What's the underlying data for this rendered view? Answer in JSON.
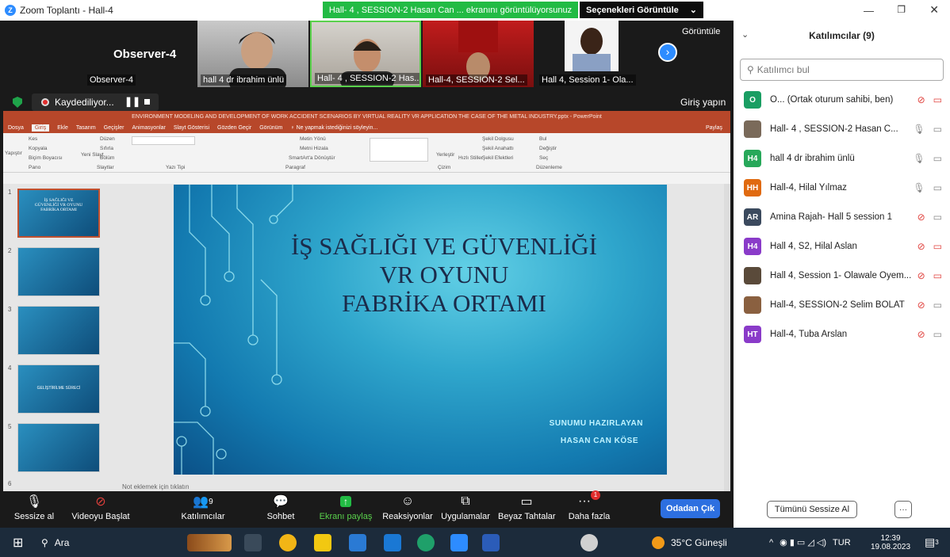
{
  "window": {
    "title": "Zoom Toplantı - Hall-4"
  },
  "share_banner": {
    "text": "Hall- 4 , SESSION-2 Hasan Can ... ekranını görüntülüyorsunuz"
  },
  "view_options": {
    "label": "Seçenekleri Görüntüle",
    "chevron": "⌄"
  },
  "video_strip": {
    "observer_big": "Observer-4",
    "tiles": [
      {
        "name": "Observer-4"
      },
      {
        "name": "hall 4 dr ibrahim ünlü"
      },
      {
        "name": "Hall- 4 , SESSION-2 Has..."
      },
      {
        "name": "Hall-4, SESSION-2 Sel..."
      },
      {
        "name": "Hall 4, Session 1- Ola..."
      }
    ],
    "view_label": "Görüntüle"
  },
  "recording": {
    "label": "Kaydediliyor...",
    "signin": "Giriş yapın"
  },
  "ppt": {
    "title": "ENVIRONMENT MODELING AND DEVELOPMENT OF WORK ACCIDENT SCENARIOS BY VIRTUAL REALITY VR APPLICATION THE CASE OF THE METAL INDUSTRY.pptx - PowerPoint",
    "tabs": [
      "Dosya",
      "Giriş",
      "Ekle",
      "Tasarım",
      "Geçişler",
      "Animasyonlar",
      "Slayt Gösterisi",
      "Gözden Geçir",
      "Görünüm",
      "♀ Ne yapmak istediğinizi söyleyin..."
    ],
    "share": "Paylaş",
    "ribbon": {
      "paste": "Yapıştır",
      "cut": "Kes",
      "copy": "Kopyala",
      "format": "Biçim Boyacısı",
      "group_clipboard": "Pano",
      "new_slide": "Yeni Slayt",
      "layout": "Düzen",
      "reset": "Sıfırla",
      "section": "Bölüm",
      "group_slides": "Slaytlar",
      "group_font": "Yazı Tipi",
      "text_dir": "Metin Yönü",
      "align": "Metni Hizala",
      "smartart": "SmartArt'a Dönüştür",
      "group_para": "Paragraf",
      "arrange": "Yerleştir",
      "quick": "Hızlı Stiller",
      "fill": "Şekil Dolgusu",
      "outline": "Şekil Anahattı",
      "effects": "Şekil Efektleri",
      "group_draw": "Çizim",
      "find": "Bul",
      "replace": "Değiştir",
      "select": "Seç",
      "group_edit": "Düzenleme"
    },
    "thumb_numbers": [
      "1",
      "2",
      "3",
      "4",
      "5",
      "6"
    ],
    "thumb1_title": "İŞ SAĞLIĞI VE GÜVENLİĞİ VR OYUNU FABRİKA ORTAMI",
    "thumb4_title": "GELİŞTİRİLME SÜRECİ",
    "notes": "Not eklemek için tıklatın",
    "slide": {
      "line1": "İŞ SAĞLIĞI VE GÜVENLİĞİ",
      "line2": "VR OYUNU",
      "line3": "FABRİKA ORTAMI",
      "sub1": "SUNUMU HAZIRLAYAN",
      "sub2": "HASAN CAN KÖSE"
    }
  },
  "controls": {
    "mute": "Sessize al",
    "video": "Videoyu Başlat",
    "participants": "Katılımcılar",
    "participants_count": "9",
    "chat": "Sohbet",
    "share": "Ekranı paylaş",
    "reactions": "Reaksiyonlar",
    "apps": "Uygulamalar",
    "whiteboard": "Beyaz Tahtalar",
    "more": "Daha fazla",
    "more_badge": "1",
    "leave": "Odadan Çık"
  },
  "panel": {
    "title": "Katılımcılar (9)",
    "search_placeholder": "Katılımcı bul",
    "participants": [
      {
        "initials": "O",
        "name": "O... (Ortak oturum sahibi, ben)",
        "color": "#1a9e63",
        "muted": true,
        "video_off": true
      },
      {
        "initials": "",
        "name": "Hall- 4 , SESSION-2 Hasan C...",
        "color": "#7a6a5a",
        "muted": false,
        "video_off": false
      },
      {
        "initials": "H4",
        "name": "hall 4 dr ibrahim ünlü",
        "color": "#27a85a",
        "muted": false,
        "video_off": false
      },
      {
        "initials": "HH",
        "name": "Hall-4, Hilal Yılmaz",
        "color": "#e06a10",
        "muted": false,
        "video_off": false
      },
      {
        "initials": "AR",
        "name": "Amina Rajah- Hall 5 session 1",
        "color": "#3b4a5e",
        "muted": true,
        "video_off": false
      },
      {
        "initials": "H4",
        "name": "Hall 4, S2, Hilal Aslan",
        "color": "#8a3bc9",
        "muted": true,
        "video_off": true
      },
      {
        "initials": "",
        "name": "Hall 4, Session 1- Olawale Oyem...",
        "color": "#5a4a3a",
        "muted": true,
        "video_off": true
      },
      {
        "initials": "",
        "name": "Hall-4, SESSION-2 Selim BOLAT",
        "color": "#8a6040",
        "muted": true,
        "video_off": false
      },
      {
        "initials": "HT",
        "name": "Hall-4, Tuba Arslan",
        "color": "#8a3bc9",
        "muted": true,
        "video_off": false
      }
    ],
    "mute_all": "Tümünü Sessize Al",
    "more": "···"
  },
  "taskbar": {
    "search": "Ara",
    "weather": "35°C Güneşli",
    "lang": "TUR",
    "time": "12:39",
    "date": "19.08.2023",
    "notif_badge": "3"
  }
}
